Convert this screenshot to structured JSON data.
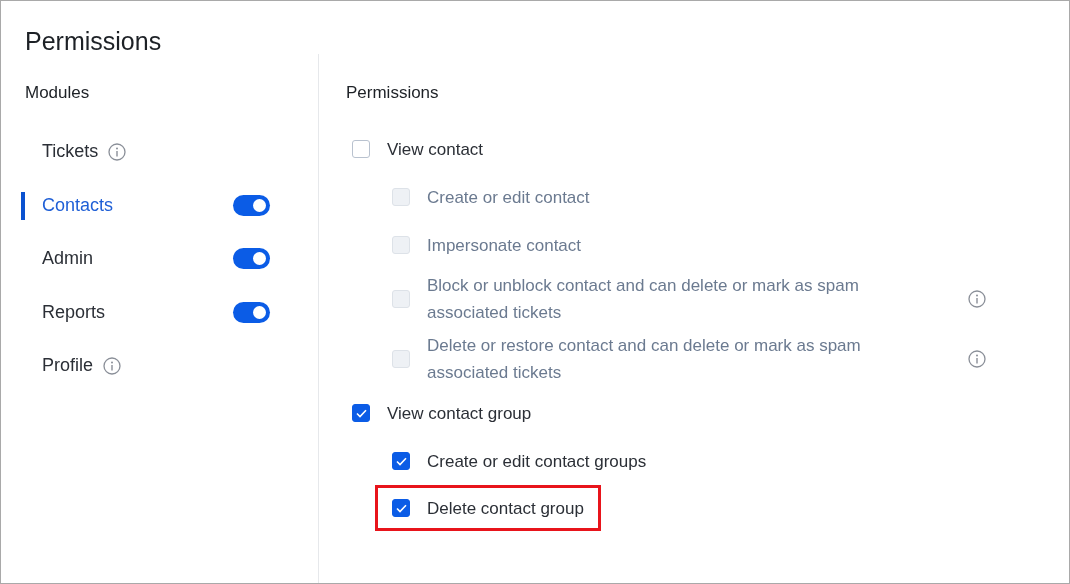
{
  "title": "Permissions",
  "modules": {
    "heading": "Modules",
    "items": [
      {
        "label": "Tickets",
        "selected": false,
        "kind": "info"
      },
      {
        "label": "Contacts",
        "selected": true,
        "kind": "toggle",
        "on": true
      },
      {
        "label": "Admin",
        "selected": false,
        "kind": "toggle",
        "on": true
      },
      {
        "label": "Reports",
        "selected": false,
        "kind": "toggle",
        "on": true
      },
      {
        "label": "Profile",
        "selected": false,
        "kind": "info"
      }
    ]
  },
  "permissions": {
    "heading": "Permissions",
    "items": [
      {
        "label": "View contact",
        "checked": false,
        "disabled": false,
        "highlighted": false,
        "info": false,
        "children": [
          {
            "label": "Create or edit contact",
            "checked": false,
            "disabled": true,
            "highlighted": false,
            "info": false
          },
          {
            "label": "Impersonate contact",
            "checked": false,
            "disabled": true,
            "highlighted": false,
            "info": false
          },
          {
            "label": "Block or unblock contact and can delete or mark as spam associated tickets",
            "checked": false,
            "disabled": true,
            "highlighted": false,
            "info": true
          },
          {
            "label": "Delete or restore contact and can delete or mark as spam associated tickets",
            "checked": false,
            "disabled": true,
            "highlighted": false,
            "info": true
          }
        ]
      },
      {
        "label": "View contact group",
        "checked": true,
        "disabled": false,
        "highlighted": false,
        "info": false,
        "children": [
          {
            "label": "Create or edit contact groups",
            "checked": true,
            "disabled": false,
            "highlighted": false,
            "info": false
          },
          {
            "label": "Delete contact group",
            "checked": true,
            "disabled": false,
            "highlighted": true,
            "info": false
          }
        ]
      }
    ]
  }
}
